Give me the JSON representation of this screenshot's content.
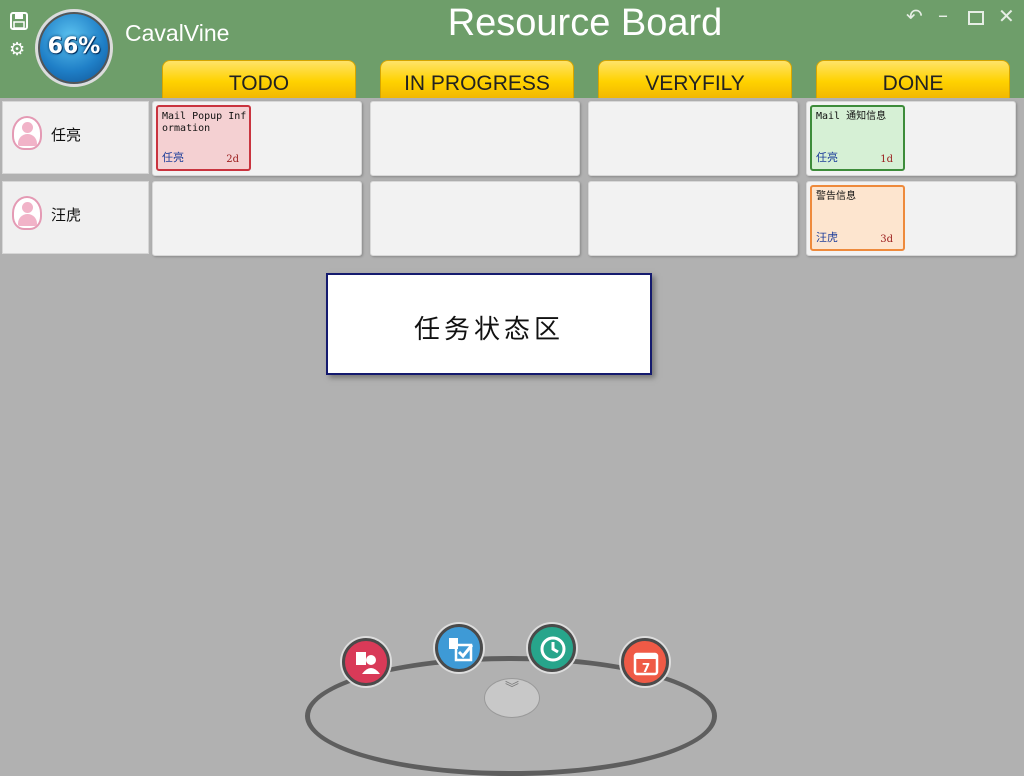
{
  "app": {
    "name": "CavalVine",
    "title": "Resource Board",
    "progress": "66%"
  },
  "columns": [
    {
      "label": "TODO"
    },
    {
      "label": "IN PROGRESS"
    },
    {
      "label": "VERYFILY"
    },
    {
      "label": "DONE"
    }
  ],
  "people": [
    {
      "name": "任亮"
    },
    {
      "name": "汪虎"
    }
  ],
  "cards": [
    {
      "title": "Mail Popup Information",
      "owner": "任亮",
      "days": "2d",
      "status": "TODO",
      "border": "#c9343f",
      "bg": "#f4d0d2"
    },
    {
      "title": "Mail 通知信息",
      "owner": "任亮",
      "days": "1d",
      "status": "DONE",
      "border": "#3d8c3a",
      "bg": "#d6f0d5"
    },
    {
      "title": "警告信息",
      "owner": "汪虎",
      "days": "3d",
      "status": "DONE",
      "border": "#ee8a3c",
      "bg": "#fde5cf"
    }
  ],
  "legend": {
    "text": "任务状态区"
  },
  "dock": [
    {
      "icon": "user-report-icon",
      "color": "#d93a58"
    },
    {
      "icon": "task-check-icon",
      "color": "#3e9ad6"
    },
    {
      "icon": "clock-icon",
      "color": "#27a58b"
    },
    {
      "icon": "calendar-icon",
      "color": "#ef5a46"
    }
  ]
}
